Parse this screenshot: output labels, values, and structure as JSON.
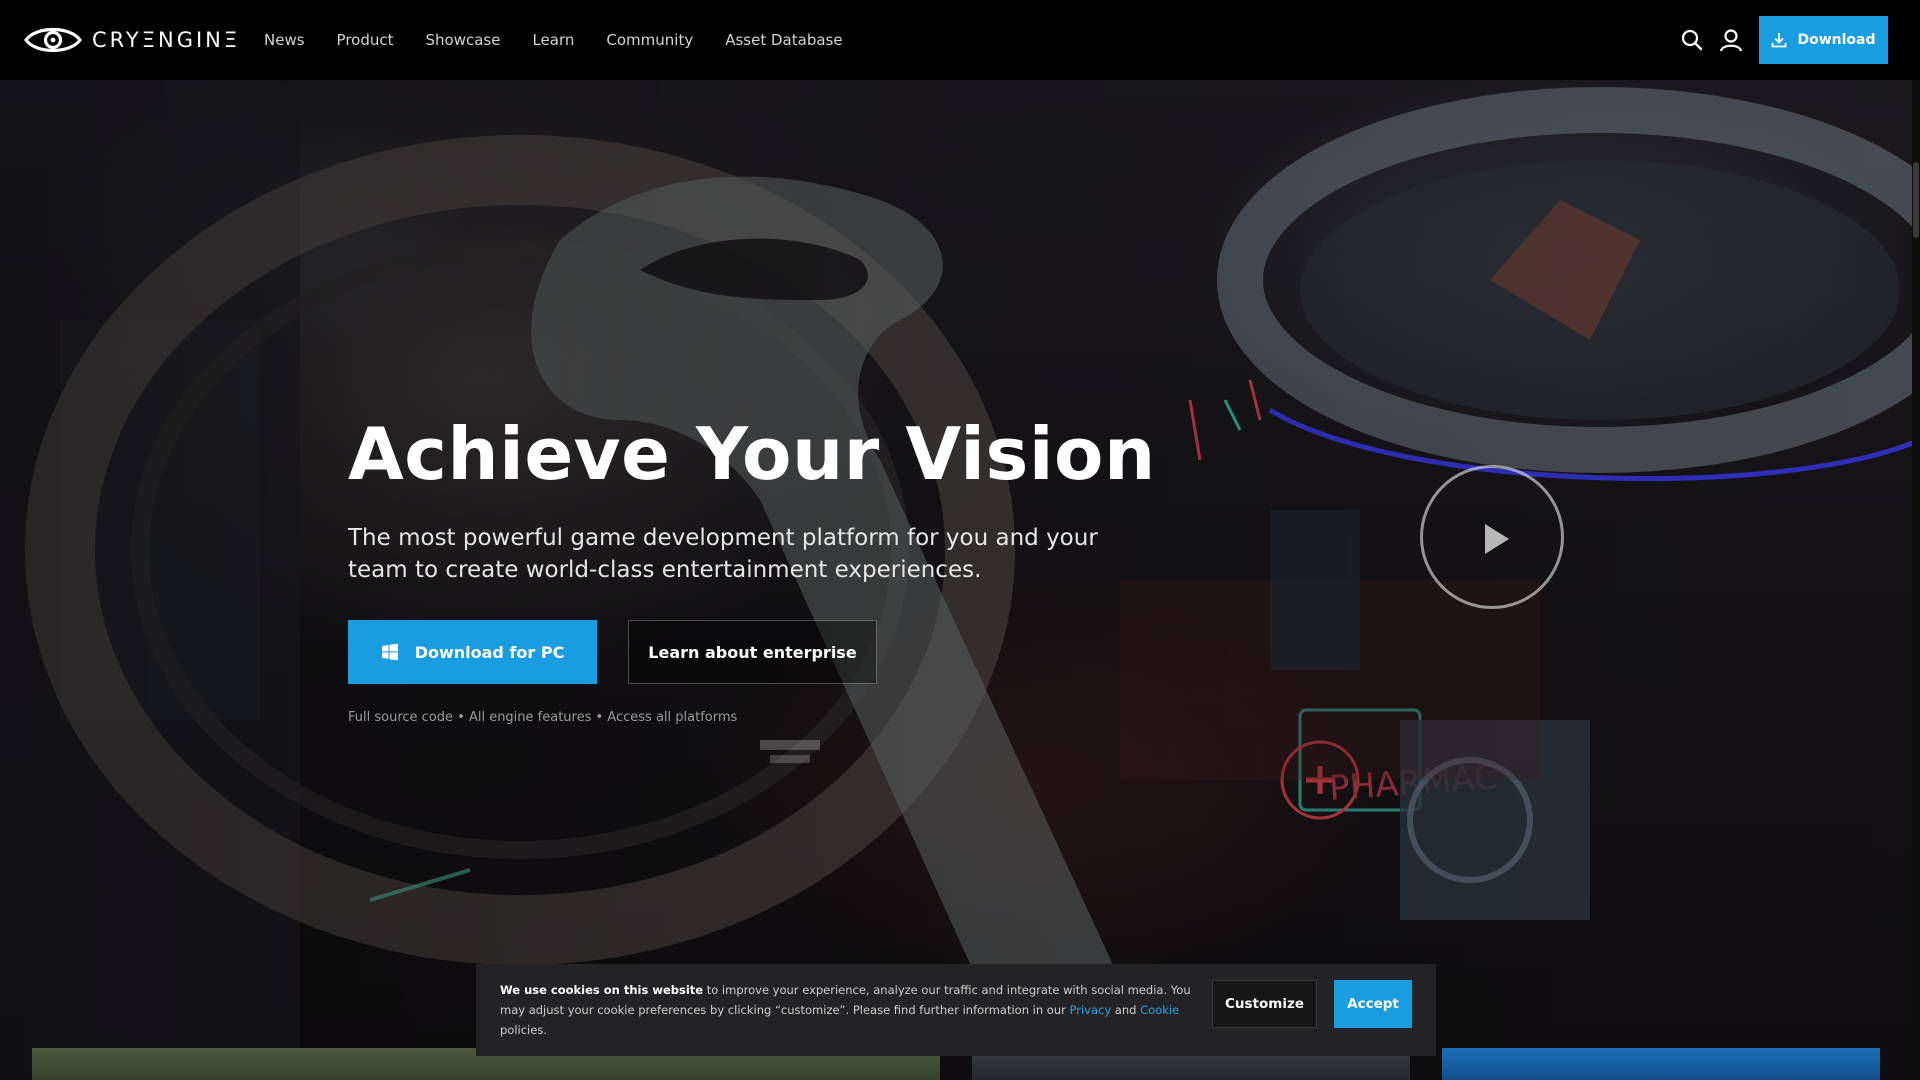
{
  "brand": {
    "name": "CRYΞNGINΞ",
    "logo_icon": "cryengine-eye-logo"
  },
  "nav": {
    "items": [
      {
        "label": "News"
      },
      {
        "label": "Product"
      },
      {
        "label": "Showcase"
      },
      {
        "label": "Learn"
      },
      {
        "label": "Community"
      },
      {
        "label": "Asset Database"
      }
    ],
    "search_icon": "search-icon",
    "account_icon": "user-icon",
    "download_label": "Download"
  },
  "hero": {
    "title": "Achieve Your Vision",
    "subtitle": "The most powerful game development platform for you and your team to create world-class entertainment experiences.",
    "primary_button": "Download for PC",
    "secondary_button": "Learn about enterprise",
    "features": "Full source code • All engine features • Access all platforms",
    "play_icon": "play-icon"
  },
  "cookie": {
    "lead": "We use cookies on this website",
    "body_1": " to improve your experience, analyze our traffic and integrate with social media. You may adjust your cookie preferences by clicking “customize”. Please find further information in our ",
    "privacy_link": "Privacy",
    "and": " and ",
    "cookie_link": "Cookie",
    "body_2": " policies.",
    "customize_label": "Customize",
    "accept_label": "Accept"
  },
  "colors": {
    "accent": "#1a9ce0",
    "link": "#29a3e8",
    "banner_bg": "#232325",
    "nav_bg": "#000000"
  }
}
